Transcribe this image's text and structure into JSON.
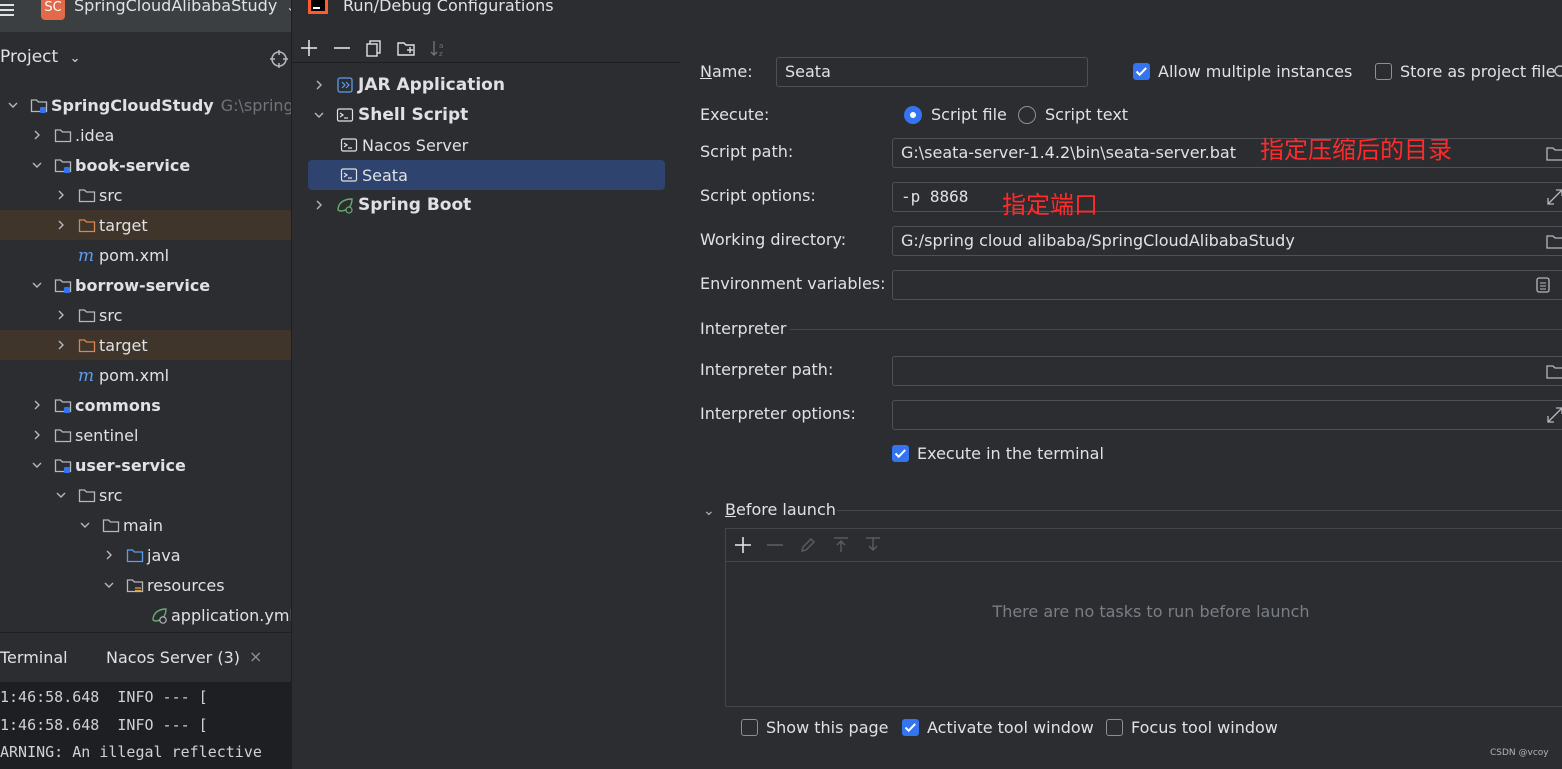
{
  "window": {
    "project_badge": "SC",
    "project_name": "SpringCloudAlibabaStudy",
    "dialog_title": "Run/Debug Configurations"
  },
  "project_panel": {
    "header": "Project",
    "tree": [
      {
        "label": "SpringCloudStudy",
        "hint": "G:\\spring c",
        "type": "module",
        "bold": true
      },
      {
        "label": ".idea",
        "type": "folder"
      },
      {
        "label": "book-service",
        "type": "module",
        "bold": true
      },
      {
        "label": "src",
        "type": "folder"
      },
      {
        "label": "target",
        "type": "folder-excluded"
      },
      {
        "label": "pom.xml",
        "type": "maven"
      },
      {
        "label": "borrow-service",
        "type": "module",
        "bold": true
      },
      {
        "label": "src",
        "type": "folder"
      },
      {
        "label": "target",
        "type": "folder-excluded"
      },
      {
        "label": "pom.xml",
        "type": "maven"
      },
      {
        "label": "commons",
        "type": "module",
        "bold": true
      },
      {
        "label": "sentinel",
        "type": "folder"
      },
      {
        "label": "user-service",
        "type": "module",
        "bold": true
      },
      {
        "label": "src",
        "type": "folder"
      },
      {
        "label": "main",
        "type": "folder"
      },
      {
        "label": "java",
        "type": "folder-source"
      },
      {
        "label": "resources",
        "type": "folder-resources"
      },
      {
        "label": "application.yml",
        "type": "spring-file"
      }
    ]
  },
  "terminal": {
    "tab_label": "Terminal",
    "session_tab": "Nacos Server (3)",
    "lines": [
      "1:46:58.648  INFO --- [",
      "1:46:58.648  INFO --- [",
      "ARNING: An illegal reflective"
    ]
  },
  "config_list": {
    "items": [
      {
        "label": "JAR Application",
        "level": 0,
        "icon": "jar-icon"
      },
      {
        "label": "Shell Script",
        "level": 0,
        "icon": "shell-icon"
      },
      {
        "label": "Nacos Server",
        "level": 1,
        "icon": "shell-icon"
      },
      {
        "label": "Seata",
        "level": 1,
        "icon": "shell-icon",
        "selected": true
      },
      {
        "label": "Spring Boot",
        "level": 0,
        "icon": "spring-boot-icon"
      }
    ]
  },
  "form": {
    "name_label": "Name:",
    "name_value": "Seata",
    "allow_multiple_label": "Allow multiple instances",
    "allow_multiple_checked": true,
    "store_as_file_label": "Store as project file",
    "store_as_file_checked": false,
    "execute_label": "Execute:",
    "script_file_label": "Script file",
    "script_text_label": "Script text",
    "script_path_label": "Script path:",
    "script_path_value": "G:\\seata-server-1.4.2\\bin\\seata-server.bat",
    "script_options_label": "Script options:",
    "script_options_value": "-p 8868",
    "working_dir_label": "Working directory:",
    "working_dir_value": "G:/spring cloud alibaba/SpringCloudAlibabaStudy",
    "env_vars_label": "Environment variables:",
    "env_vars_value": "",
    "interpreter_section": "Interpreter",
    "interpreter_path_label": "Interpreter path:",
    "interpreter_path_value": "",
    "interpreter_options_label": "Interpreter options:",
    "interpreter_options_value": "",
    "execute_in_terminal_label": "Execute in the terminal",
    "execute_in_terminal_checked": true,
    "before_launch_label": "Before launch",
    "before_launch_empty": "There are no tasks to run before launch",
    "show_page_label": "Show this page",
    "show_page_checked": false,
    "activate_tool_label": "Activate tool window",
    "activate_tool_checked": true,
    "focus_tool_label": "Focus tool window",
    "focus_tool_checked": false
  },
  "annotations": {
    "path_note": "指定压缩后的目录",
    "port_note": "指定端口"
  },
  "watermark": "CSDN @vcoy",
  "colors": {
    "accent": "#3574f0",
    "annotation": "#ff2b2b",
    "selection": "#2e436e"
  }
}
